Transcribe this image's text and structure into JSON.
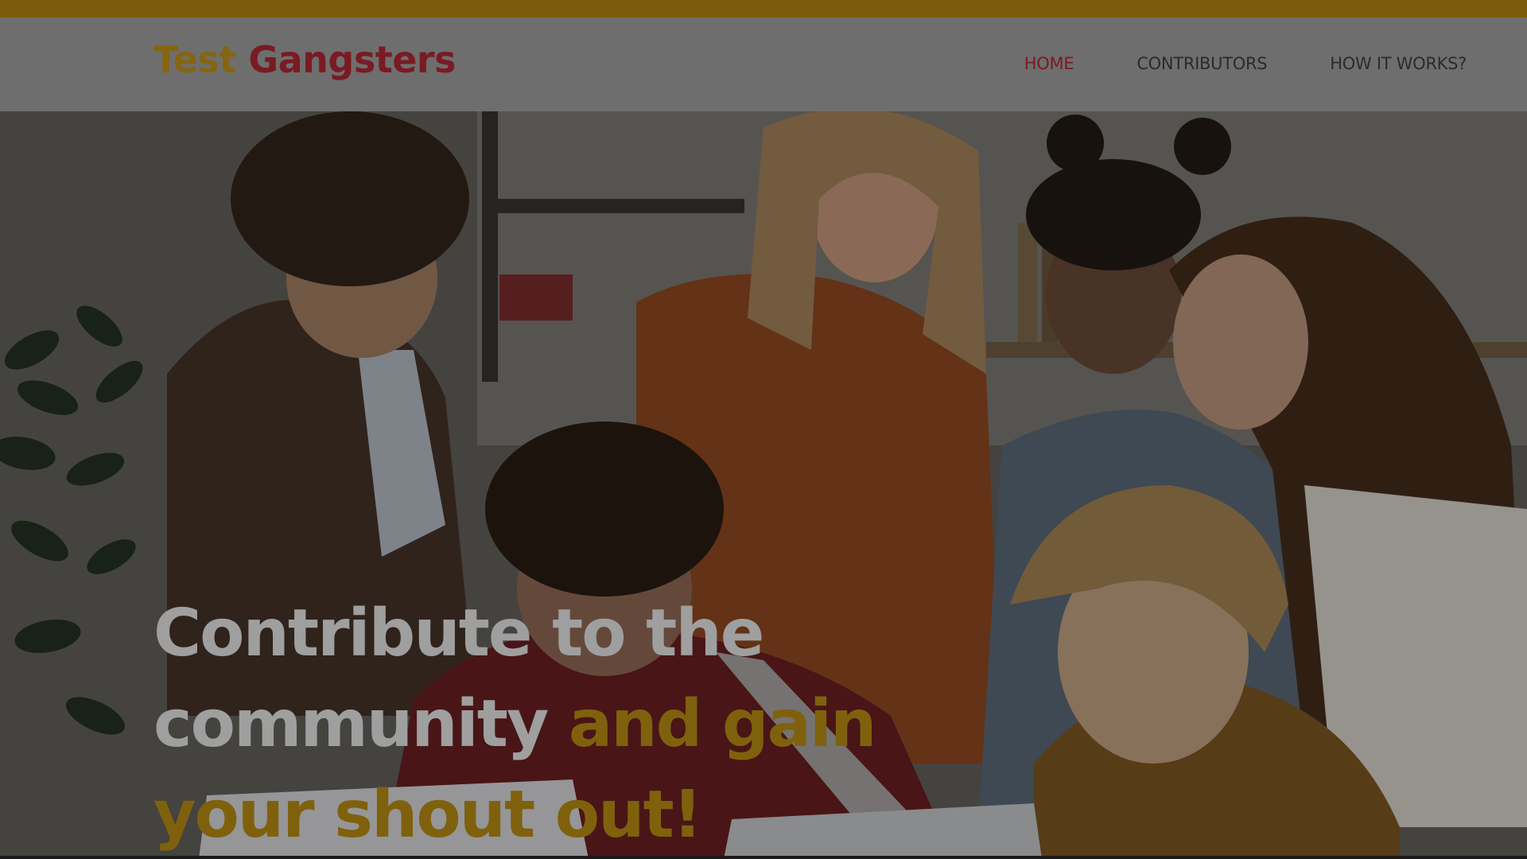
{
  "brand": {
    "word1": "Test",
    "word2": "Gangsters",
    "color1": "#866511",
    "color2": "#7a1a22"
  },
  "nav": {
    "items": [
      {
        "label": "HOME",
        "active": true
      },
      {
        "label": "CONTRIBUTORS",
        "active": false
      },
      {
        "label": "HOW IT WORKS?",
        "active": false
      }
    ],
    "active_color": "#7a1a22"
  },
  "hero": {
    "headline_part1": "Contribute to the community",
    "headline_part2": "and gain your shout out!",
    "headline_color": "#9f9f9f",
    "highlight_color": "#7f610d",
    "image": "students gathered around laptops in a classroom"
  },
  "colors": {
    "top_accent": "#7a5c0a"
  }
}
